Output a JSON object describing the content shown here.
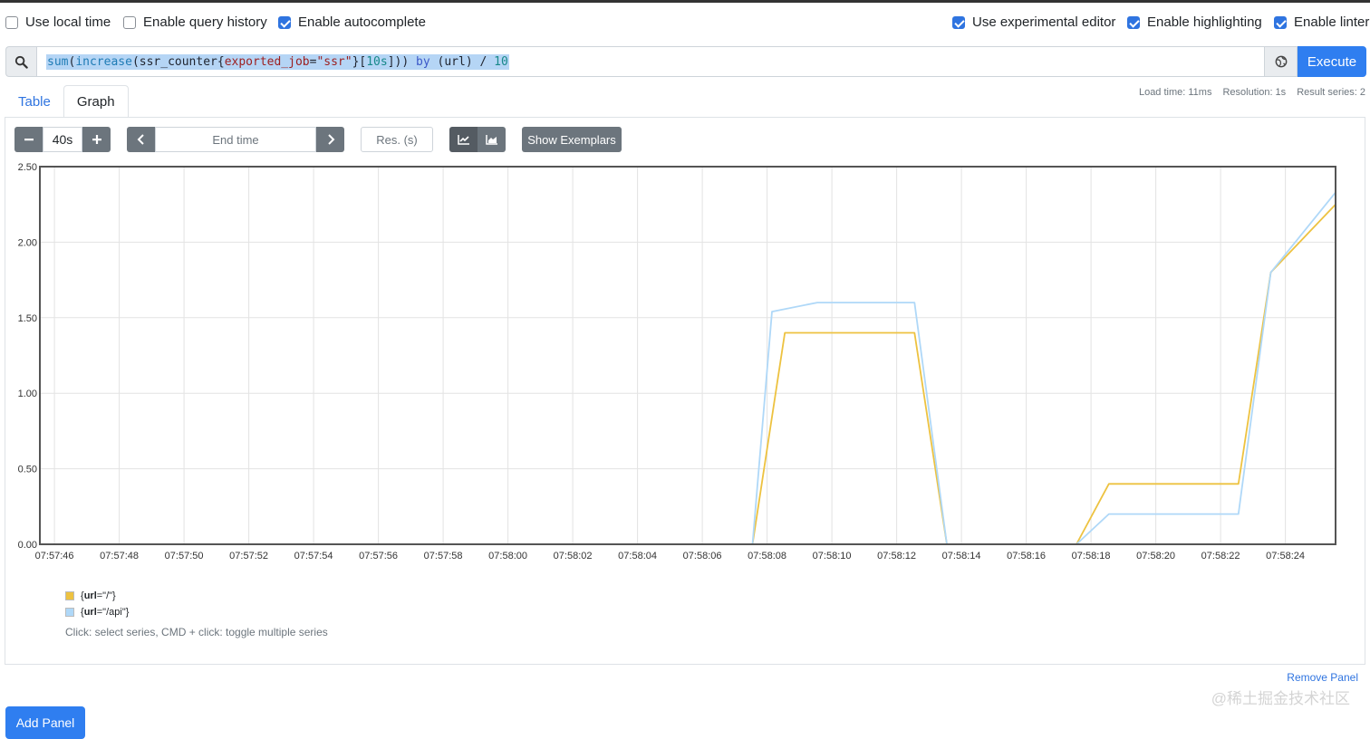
{
  "options": {
    "left": [
      {
        "label": "Use local time",
        "checked": false
      },
      {
        "label": "Enable query history",
        "checked": false
      },
      {
        "label": "Enable autocomplete",
        "checked": true
      }
    ],
    "right": [
      {
        "label": "Use experimental editor",
        "checked": true
      },
      {
        "label": "Enable highlighting",
        "checked": true
      },
      {
        "label": "Enable linter",
        "checked": true
      }
    ]
  },
  "expression": {
    "tokens": [
      {
        "t": "sum",
        "c": "fn"
      },
      {
        "t": "(",
        "c": "plain"
      },
      {
        "t": "increase",
        "c": "fn"
      },
      {
        "t": "(",
        "c": "plain"
      },
      {
        "t": "ssr_counter",
        "c": "plain"
      },
      {
        "t": "{",
        "c": "plain"
      },
      {
        "t": "exported_job",
        "c": "str"
      },
      {
        "t": "=",
        "c": "plain"
      },
      {
        "t": "\"ssr\"",
        "c": "str"
      },
      {
        "t": "}",
        "c": "plain"
      },
      {
        "t": "[",
        "c": "plain"
      },
      {
        "t": "10s",
        "c": "num"
      },
      {
        "t": "]",
        "c": "plain"
      },
      {
        "t": ")) ",
        "c": "plain"
      },
      {
        "t": "by",
        "c": "kw"
      },
      {
        "t": " (url) / ",
        "c": "plain"
      },
      {
        "t": "10",
        "c": "num"
      }
    ],
    "execute_label": "Execute"
  },
  "stats": {
    "load_time": "Load time: 11ms",
    "resolution": "Resolution: 1s",
    "result_series": "Result series: 2"
  },
  "tabs": [
    {
      "label": "Table",
      "active": false
    },
    {
      "label": "Graph",
      "active": true
    }
  ],
  "controls": {
    "range_value": "40s",
    "end_time_placeholder": "End time",
    "res_placeholder": "Res. (s)",
    "show_exemplars_label": "Show Exemplars"
  },
  "chart_data": {
    "type": "line",
    "title": "",
    "xlabel": "",
    "ylabel": "",
    "x_ticks": [
      "07:57:46",
      "07:57:48",
      "07:57:50",
      "07:57:52",
      "07:57:54",
      "07:57:56",
      "07:57:58",
      "07:58:00",
      "07:58:02",
      "07:58:04",
      "07:58:06",
      "07:58:08",
      "07:58:10",
      "07:58:12",
      "07:58:14",
      "07:58:16",
      "07:58:18",
      "07:58:20",
      "07:58:22",
      "07:58:24"
    ],
    "y_ticks": [
      "0.00",
      "0.50",
      "1.00",
      "1.50",
      "2.00",
      "2.50"
    ],
    "ylim": [
      0,
      2.5
    ],
    "xlim": [
      "07:57:45.55",
      "07:58:25.55"
    ],
    "grid": true,
    "series": [
      {
        "name": "{url=\"/\"}",
        "color": "#edc240",
        "points": [
          [
            "07:57:45.55",
            0
          ],
          [
            "07:58:07.55",
            0
          ],
          [
            "07:58:08.55",
            1.4
          ],
          [
            "07:58:12.55",
            1.4
          ],
          [
            "07:58:13.55",
            0
          ],
          [
            "07:58:17.55",
            0
          ],
          [
            "07:58:18.55",
            0.4
          ],
          [
            "07:58:22.55",
            0.4
          ],
          [
            "07:58:23.55",
            1.8
          ],
          [
            "07:58:25.55",
            2.25
          ]
        ]
      },
      {
        "name": "{url=\"/api\"}",
        "color": "#afd8f8",
        "points": [
          [
            "07:57:45.55",
            0
          ],
          [
            "07:58:07.55",
            0
          ],
          [
            "07:58:08.15",
            1.54
          ],
          [
            "07:58:09.55",
            1.6
          ],
          [
            "07:58:12.55",
            1.6
          ],
          [
            "07:58:13.55",
            0
          ],
          [
            "07:58:17.55",
            0
          ],
          [
            "07:58:18.55",
            0.2
          ],
          [
            "07:58:22.55",
            0.2
          ],
          [
            "07:58:23.55",
            1.8
          ],
          [
            "07:58:25.55",
            2.33
          ]
        ]
      }
    ]
  },
  "legend": {
    "items": [
      {
        "key": "url",
        "value": "=\"/\"}",
        "color": "#edc240"
      },
      {
        "key": "url",
        "value": "=\"/api\"}",
        "color": "#afd8f8"
      }
    ],
    "hint": "Click: select series, CMD + click: toggle multiple series"
  },
  "remove_panel_label": "Remove Panel",
  "add_panel_label": "Add Panel",
  "watermark": "@稀土掘金技术社区"
}
